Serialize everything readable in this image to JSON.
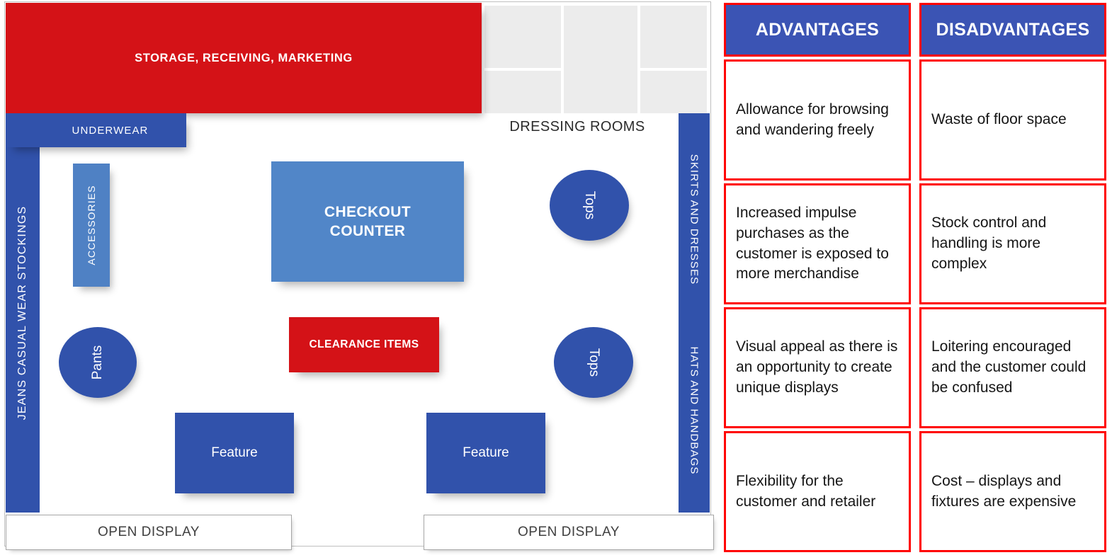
{
  "floorplan": {
    "storage": "STORAGE, RECEIVING, MARKETING",
    "dressing_rooms": "DRESSING ROOMS",
    "left_wall": "JEANS  CASUAL WEAR  STOCKINGS",
    "right_wall_top": "SKIRTS AND DRESSES",
    "right_wall_bottom": "HATS AND HANDBAGS",
    "underwear": "UNDERWEAR",
    "accessories": "ACCESSORIES",
    "checkout_line1": "CHECKOUT",
    "checkout_line2": "COUNTER",
    "clearance": "CLEARANCE ITEMS",
    "pants": "Pants",
    "tops_upper": "Tops",
    "tops_lower": "Tops",
    "feature_left": "Feature",
    "feature_right": "Feature",
    "open_display_left": "OPEN DISPLAY",
    "open_display_right": "OPEN DISPLAY",
    "colors": {
      "red": "#d41217",
      "dark_blue": "#3152ab",
      "light_blue": "#5186c8",
      "accessories_blue": "#4f81c4",
      "dressing_room_gray": "#ececec",
      "outline_gray": "#bfbfbf"
    }
  },
  "table": {
    "headers": [
      "ADVANTAGES",
      "DISADVANTAGES"
    ],
    "rows": [
      {
        "advantage": "Allowance for browsing and wandering freely",
        "disadvantage": "Waste of floor space"
      },
      {
        "advantage": "Increased impulse purchases as the customer is exposed to more merchandise",
        "disadvantage": "Stock control and handling is more complex"
      },
      {
        "advantage": "Visual appeal as there is an opportunity to create unique displays",
        "disadvantage": "Loitering encouraged and the customer could be confused"
      },
      {
        "advantage": "Flexibility for the customer and retailer",
        "disadvantage": "Cost – displays and fixtures are expensive"
      }
    ],
    "colors": {
      "header_blue": "#3b54b4",
      "border_red": "#ff0000"
    }
  }
}
